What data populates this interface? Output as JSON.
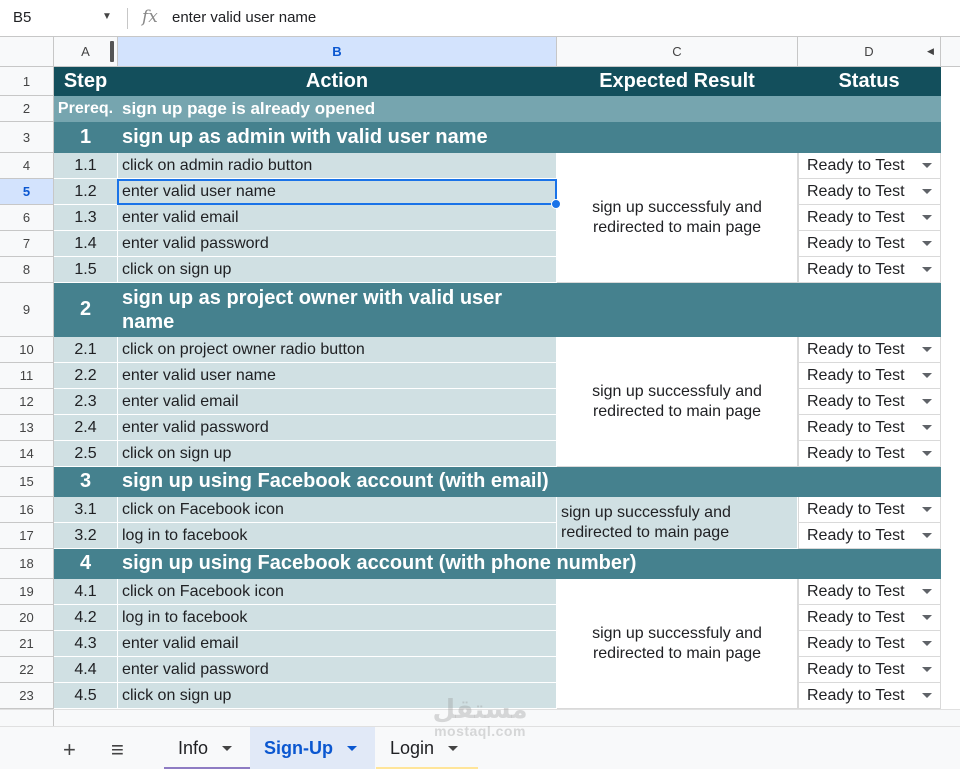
{
  "formula_bar": {
    "cell_ref": "B5",
    "fx_label": "fx",
    "content": "enter valid user name"
  },
  "columns": [
    "A",
    "B",
    "C",
    "D"
  ],
  "selected_column": "B",
  "selected_row": "5",
  "row_numbers": [
    "1",
    "2",
    "3",
    "4",
    "5",
    "6",
    "7",
    "8",
    "9",
    "10",
    "11",
    "12",
    "13",
    "14",
    "15",
    "16",
    "17",
    "18",
    "19",
    "20",
    "21",
    "22",
    "23"
  ],
  "header": {
    "step": "Step",
    "action": "Action",
    "expected": "Expected Result",
    "status": "Status"
  },
  "prereq": {
    "label": "Prereq.",
    "text": "sign up page is already opened"
  },
  "groups": [
    {
      "step": "1",
      "title": "sign up as admin with valid user name",
      "expected": "sign up successfuly and redirected to main page",
      "steps": [
        {
          "n": "1.1",
          "action": "click on admin radio button",
          "status": "Ready to Test"
        },
        {
          "n": "1.2",
          "action": "enter valid user name",
          "status": "Ready to Test"
        },
        {
          "n": "1.3",
          "action": "enter valid  email",
          "status": "Ready to Test"
        },
        {
          "n": "1.4",
          "action": "enter valid password",
          "status": "Ready to Test"
        },
        {
          "n": "1.5",
          "action": "click on sign up",
          "status": "Ready to Test"
        }
      ]
    },
    {
      "step": "2",
      "title": "sign up as project owner with valid user name",
      "expected": "sign up successfuly and redirected to main page",
      "steps": [
        {
          "n": "2.1",
          "action": "click on project owner radio button",
          "status": "Ready to Test"
        },
        {
          "n": "2.2",
          "action": "enter valid user name",
          "status": "Ready to Test"
        },
        {
          "n": "2.3",
          "action": "enter valid  email",
          "status": "Ready to Test"
        },
        {
          "n": "2.4",
          "action": "enter valid password",
          "status": "Ready to Test"
        },
        {
          "n": "2.5",
          "action": "click on sign up",
          "status": "Ready to Test"
        }
      ]
    },
    {
      "step": "3",
      "title": "sign up using Facebook account (with email)",
      "expected": "sign up successfuly and redirected to main page",
      "steps": [
        {
          "n": "3.1",
          "action": "click on Facebook icon",
          "status": "Ready to Test"
        },
        {
          "n": "3.2",
          "action": "log in to facebook",
          "status": "Ready to Test"
        }
      ]
    },
    {
      "step": "4",
      "title": "sign up using Facebook account (with phone number)",
      "expected": "sign up successfuly and redirected to main page",
      "steps": [
        {
          "n": "4.1",
          "action": "click on Facebook icon",
          "status": "Ready to Test"
        },
        {
          "n": "4.2",
          "action": "log in to facebook",
          "status": "Ready to Test"
        },
        {
          "n": "4.3",
          "action": "enter valid  email",
          "status": "Ready to Test"
        },
        {
          "n": "4.4",
          "action": "enter valid password",
          "status": "Ready to Test"
        },
        {
          "n": "4.5",
          "action": "click on sign up",
          "status": "Ready to Test"
        }
      ]
    }
  ],
  "sheet_tabs": [
    {
      "label": "Info",
      "active": false,
      "color": "#8e7cc3"
    },
    {
      "label": "Sign-Up",
      "active": true,
      "color": "#c9daf8"
    },
    {
      "label": "Login",
      "active": false,
      "color": "#ffe599"
    }
  ],
  "icons": {
    "add_sheet": "plus-icon",
    "all_sheets": "menu-icon"
  },
  "watermark": {
    "arabic": "مستقل",
    "latin": "mostaql.com"
  },
  "colors": {
    "header": "#134f5c",
    "prereq": "#76a5af",
    "group": "#45818e",
    "row_bg": "#d0e0e3",
    "selection": "#1a73e8"
  }
}
